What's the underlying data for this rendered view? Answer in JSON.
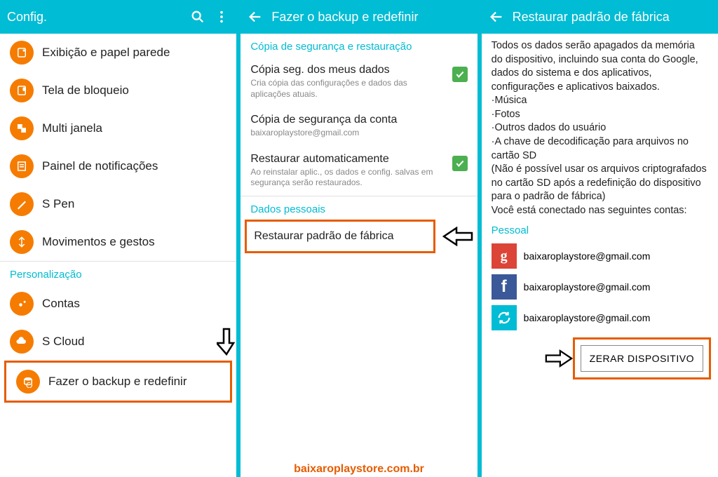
{
  "panel1": {
    "header": {
      "title": "Config."
    },
    "items": [
      {
        "label": "Exibição e papel parede"
      },
      {
        "label": "Tela de bloqueio"
      },
      {
        "label": "Multi janela"
      },
      {
        "label": "Painel de notificações"
      },
      {
        "label": "S Pen"
      },
      {
        "label": "Movimentos e gestos"
      }
    ],
    "section": "Personalização",
    "items2": [
      {
        "label": "Contas"
      },
      {
        "label": "S Cloud"
      },
      {
        "label": "Fazer o backup e redefinir"
      }
    ]
  },
  "panel2": {
    "header": {
      "title": "Fazer o backup e redefinir"
    },
    "section1": "Cópia de segurança e restauração",
    "opt1": {
      "title": "Cópia seg. dos meus dados",
      "sub": "Cria cópia das configurações e dados das aplicações atuais."
    },
    "opt2": {
      "title": "Cópia de segurança da conta",
      "sub": "baixaroplaystore@gmail.com"
    },
    "opt3": {
      "title": "Restaurar automaticamente",
      "sub": "Ao reinstalar aplic., os dados e config. salvas em segurança serão restaurados."
    },
    "section2": "Dados pessoais",
    "opt4": {
      "title": "Restaurar padrão de fábrica"
    },
    "watermark": "baixaroplaystore.com.br"
  },
  "panel3": {
    "header": {
      "title": "Restaurar padrão de fábrica"
    },
    "intro": "Todos os dados serão apagados da memória do dispositivo, incluindo sua conta do Google, dados do sistema e dos aplicativos, configurações e aplicativos baixados.",
    "bul1": "·Música",
    "bul2": "·Fotos",
    "bul3": "·Outros dados do usuário",
    "bul4": "·A chave de decodificação para arquivos no cartão SD",
    "note": "(Não é possível usar os arquivos criptografados no cartão SD após a redefinição do dispositivo para o padrão de fábrica)",
    "connected": "Você está conectado nas seguintes contas:",
    "section": "Pessoal",
    "accounts": [
      {
        "email": "baixaroplaystore@gmail.com"
      },
      {
        "email": "baixaroplaystore@gmail.com"
      },
      {
        "email": "baixaroplaystore@gmail.com"
      }
    ],
    "reset_btn": "ZERAR DISPOSITIVO"
  }
}
